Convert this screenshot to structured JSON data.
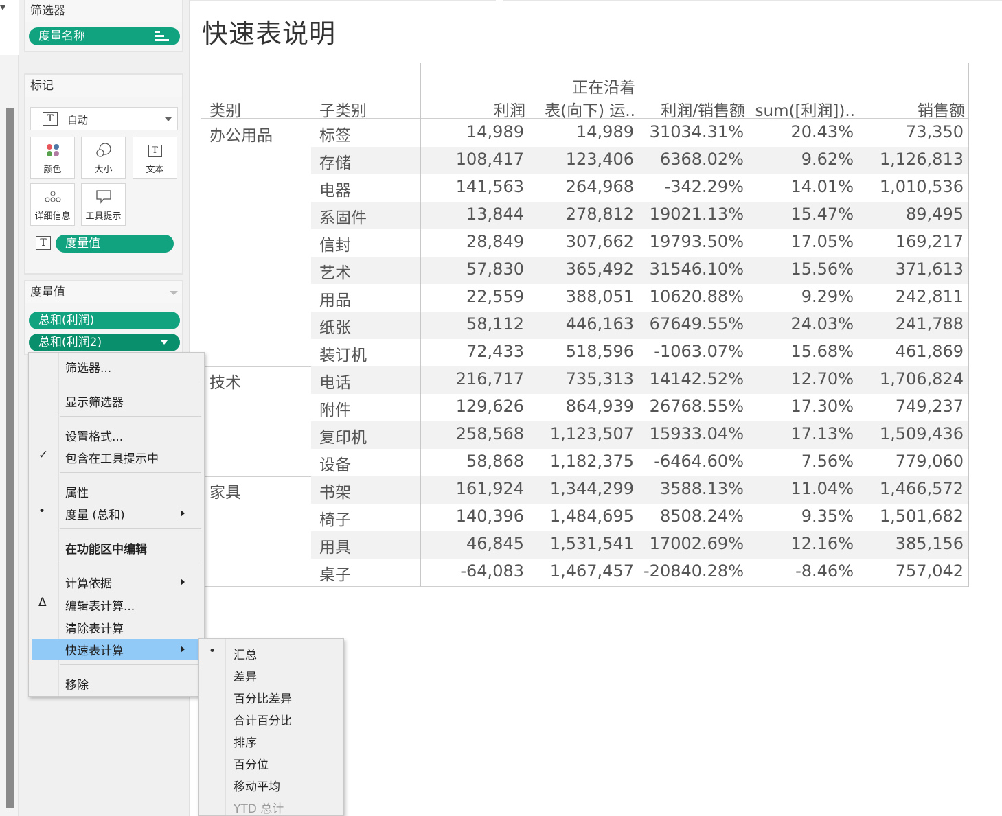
{
  "sidebar": {
    "filters": {
      "title": "筛选器",
      "pill": "度量名称"
    },
    "marks": {
      "title": "标记",
      "type_select": "自动",
      "buttons": [
        {
          "label": "颜色",
          "icon": "color-icon"
        },
        {
          "label": "大小",
          "icon": "size-icon"
        },
        {
          "label": "文本",
          "icon": "text-icon"
        },
        {
          "label": "详细信息",
          "icon": "detail-icon"
        },
        {
          "label": "工具提示",
          "icon": "tooltip-icon"
        }
      ],
      "field_pill": "度量值"
    },
    "measure_values": {
      "title": "度量值",
      "pills": [
        "总和(利润)",
        "总和(利润2)"
      ]
    }
  },
  "main": {
    "title": "快速表说明",
    "headers": [
      "类别",
      "子类别",
      "利润",
      "正在沿着",
      "表(向下) 运..",
      "利润/销售额",
      "sum([利润])..",
      "销售额"
    ],
    "groups": [
      {
        "category": "办公用品",
        "rows": [
          [
            "标签",
            "14,989",
            "14,989",
            "31034.31%",
            "20.43%",
            "73,350"
          ],
          [
            "存储",
            "108,417",
            "123,406",
            "6368.02%",
            "9.62%",
            "1,126,813"
          ],
          [
            "电器",
            "141,563",
            "264,968",
            "-342.29%",
            "14.01%",
            "1,010,536"
          ],
          [
            "系固件",
            "13,844",
            "278,812",
            "19021.13%",
            "15.47%",
            "89,495"
          ],
          [
            "信封",
            "28,849",
            "307,662",
            "19793.50%",
            "17.05%",
            "169,217"
          ],
          [
            "艺术",
            "57,830",
            "365,492",
            "31546.10%",
            "15.56%",
            "371,613"
          ],
          [
            "用品",
            "22,559",
            "388,051",
            "10620.88%",
            "9.29%",
            "242,811"
          ],
          [
            "纸张",
            "58,112",
            "446,163",
            "67649.55%",
            "24.03%",
            "241,788"
          ],
          [
            "装订机",
            "72,433",
            "518,596",
            "-1063.07%",
            "15.68%",
            "461,869"
          ]
        ]
      },
      {
        "category": "技术",
        "rows": [
          [
            "电话",
            "216,717",
            "735,313",
            "14142.52%",
            "12.70%",
            "1,706,824"
          ],
          [
            "附件",
            "129,626",
            "864,939",
            "26768.55%",
            "17.30%",
            "749,237"
          ],
          [
            "复印机",
            "258,568",
            "1,123,507",
            "15933.04%",
            "17.13%",
            "1,509,436"
          ],
          [
            "设备",
            "58,868",
            "1,182,375",
            "-6464.60%",
            "7.56%",
            "779,060"
          ]
        ]
      },
      {
        "category": "家具",
        "rows": [
          [
            "书架",
            "161,924",
            "1,344,299",
            "3588.13%",
            "11.04%",
            "1,466,572"
          ],
          [
            "椅子",
            "140,396",
            "1,484,695",
            "8508.24%",
            "9.35%",
            "1,501,682"
          ],
          [
            "用具",
            "46,845",
            "1,531,541",
            "17002.69%",
            "12.16%",
            "385,156"
          ],
          [
            "桌子",
            "-64,083",
            "1,467,457",
            "-20840.28%",
            "-8.46%",
            "757,042"
          ]
        ]
      }
    ]
  },
  "context_menu": {
    "items": [
      {
        "label": "筛选器...",
        "mark": "",
        "submenu": false
      },
      {
        "label": "显示筛选器",
        "mark": "",
        "submenu": false
      },
      {
        "label": "设置格式...",
        "mark": "",
        "submenu": false
      },
      {
        "label": "包含在工具提示中",
        "mark": "✓",
        "submenu": false
      },
      {
        "label": "属性",
        "mark": "",
        "submenu": false
      },
      {
        "label": "度量 (总和)",
        "mark": "•",
        "submenu": true
      },
      {
        "label": "在功能区中编辑",
        "mark": "",
        "submenu": false
      },
      {
        "label": "计算依据",
        "mark": "",
        "submenu": true
      },
      {
        "label": "编辑表计算...",
        "mark": "Δ",
        "submenu": false
      },
      {
        "label": "清除表计算",
        "mark": "",
        "submenu": false
      },
      {
        "label": "快速表计算",
        "mark": "",
        "submenu": true
      },
      {
        "label": "移除",
        "mark": "",
        "submenu": false
      }
    ]
  },
  "quick_table_calc_submenu": {
    "items": [
      {
        "label": "汇总",
        "mark": "•"
      },
      {
        "label": "差异",
        "mark": ""
      },
      {
        "label": "百分比差异",
        "mark": ""
      },
      {
        "label": "合计百分比",
        "mark": ""
      },
      {
        "label": "排序",
        "mark": ""
      },
      {
        "label": "百分位",
        "mark": ""
      },
      {
        "label": "移动平均",
        "mark": ""
      },
      {
        "label": "YTD 总计",
        "mark": ""
      }
    ]
  },
  "colors": {
    "pill_green": "#11a37f",
    "menu_highlight": "#91c9f7"
  }
}
